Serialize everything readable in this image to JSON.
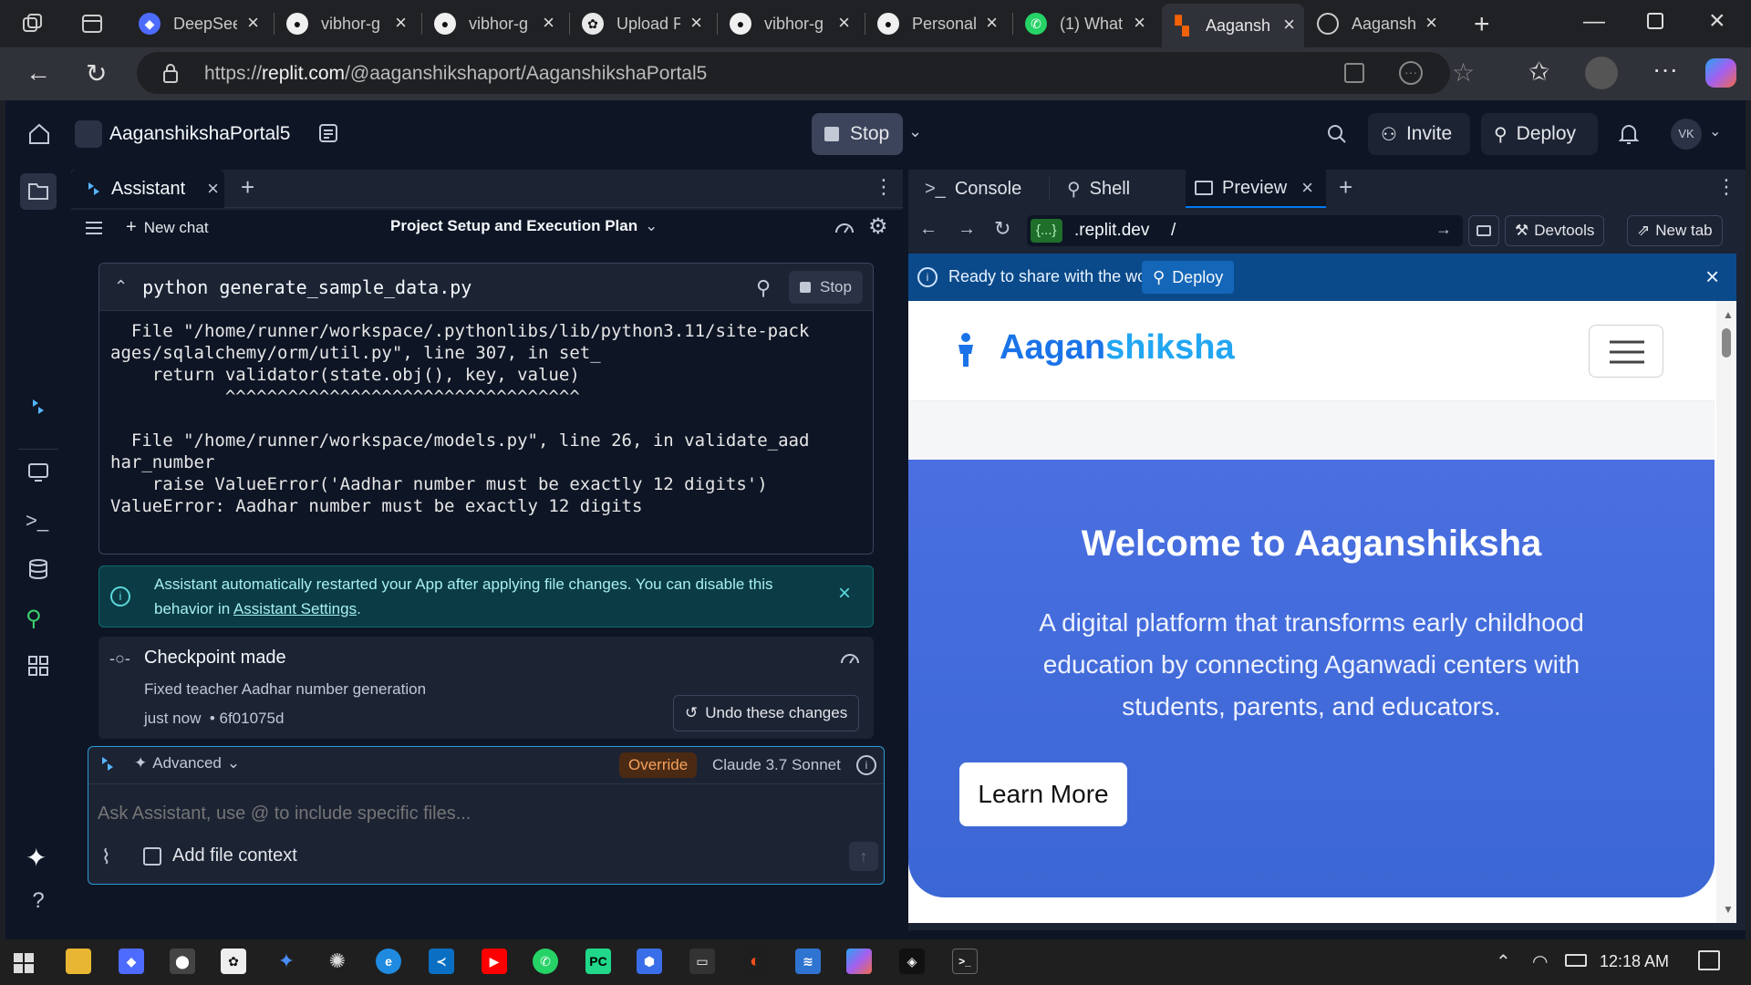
{
  "browser": {
    "tabs": [
      {
        "label": "DeepSee",
        "icon": "deepseek-icon"
      },
      {
        "label": "vibhor-g",
        "icon": "github-icon"
      },
      {
        "label": "vibhor-g",
        "icon": "github-icon"
      },
      {
        "label": "Upload F",
        "icon": "openai-icon"
      },
      {
        "label": "vibhor-g",
        "icon": "github-icon"
      },
      {
        "label": "Personal",
        "icon": "github-icon"
      },
      {
        "label": "(1) What",
        "icon": "whatsapp-icon"
      },
      {
        "label": "Aagansh",
        "icon": "replit-icon"
      },
      {
        "label": "Aagansh",
        "icon": "globe-icon"
      }
    ],
    "url_prefix": "https://",
    "url_domain": "replit.com",
    "url_path": "/@aaganshikshaport/AaganshikshaPortal5"
  },
  "replit": {
    "project_name": "AaganshikshaPortal5",
    "stop_label": "Stop",
    "invite_label": "Invite",
    "deploy_label": "Deploy",
    "avatar_initials": "VK"
  },
  "assistant": {
    "tab_label": "Assistant",
    "new_chat_label": "New chat",
    "chat_title": "Project Setup and Execution Plan",
    "command": "python generate_sample_data.py",
    "command_stop_label": "Stop",
    "code_lines": [
      "  File \"/home/runner/workspace/.pythonlibs/lib/python3.11/site-pack",
      "ages/sqlalchemy/orm/util.py\", line 307, in set_",
      "    return validator(state.obj(), key, value)",
      "           ^^^^^^^^^^^^^^^^^^^^^^^^^^^^^^^^^^",
      "",
      "  File \"/home/runner/workspace/models.py\", line 26, in validate_aad",
      "har_number",
      "    raise ValueError('Aadhar number must be exactly 12 digits')",
      "ValueError: Aadhar number must be exactly 12 digits"
    ],
    "info_text_1": "Assistant automatically restarted your App after applying file changes. You can disable this",
    "info_text_2_prefix": "behavior in ",
    "info_link": "Assistant Settings",
    "info_text_2_suffix": ".",
    "checkpoint_title": "Checkpoint made",
    "checkpoint_desc": "Fixed teacher Aadhar number generation",
    "checkpoint_time": "just now",
    "checkpoint_hash": "• 6f01075d",
    "undo_label": "Undo these changes",
    "mode_label": "Advanced",
    "override_label": "Override",
    "model_label": "Claude 3.7 Sonnet",
    "input_placeholder": "Ask Assistant, use @ to include specific files...",
    "add_context_label": "Add file context"
  },
  "preview": {
    "tabs": [
      "Console",
      "Shell",
      "Preview"
    ],
    "url_badge": "{...}",
    "url_host": ".replit.dev",
    "url_path": "/",
    "devtools_label": "Devtools",
    "newtab_label": "New tab",
    "banner_text": "Ready to share with the world?",
    "banner_deploy": "Deploy",
    "site_brand_1": "Aagan",
    "site_brand_2": "shiksha",
    "hero_title": "Welcome to Aaganshiksha",
    "hero_text_1": "A digital platform that transforms early childhood",
    "hero_text_2": "education by connecting Aganwadi centers with",
    "hero_text_3": "students, parents, and educators.",
    "hero_button": "Learn More"
  },
  "taskbar": {
    "time": "12:18 AM"
  },
  "colors": {
    "replit_bg": "#0e1525",
    "panel_bg": "#1c2333",
    "accent_blue": "#0079f2",
    "hero_blue": "#4a6fe0",
    "info_teal": "#0b3b44"
  }
}
